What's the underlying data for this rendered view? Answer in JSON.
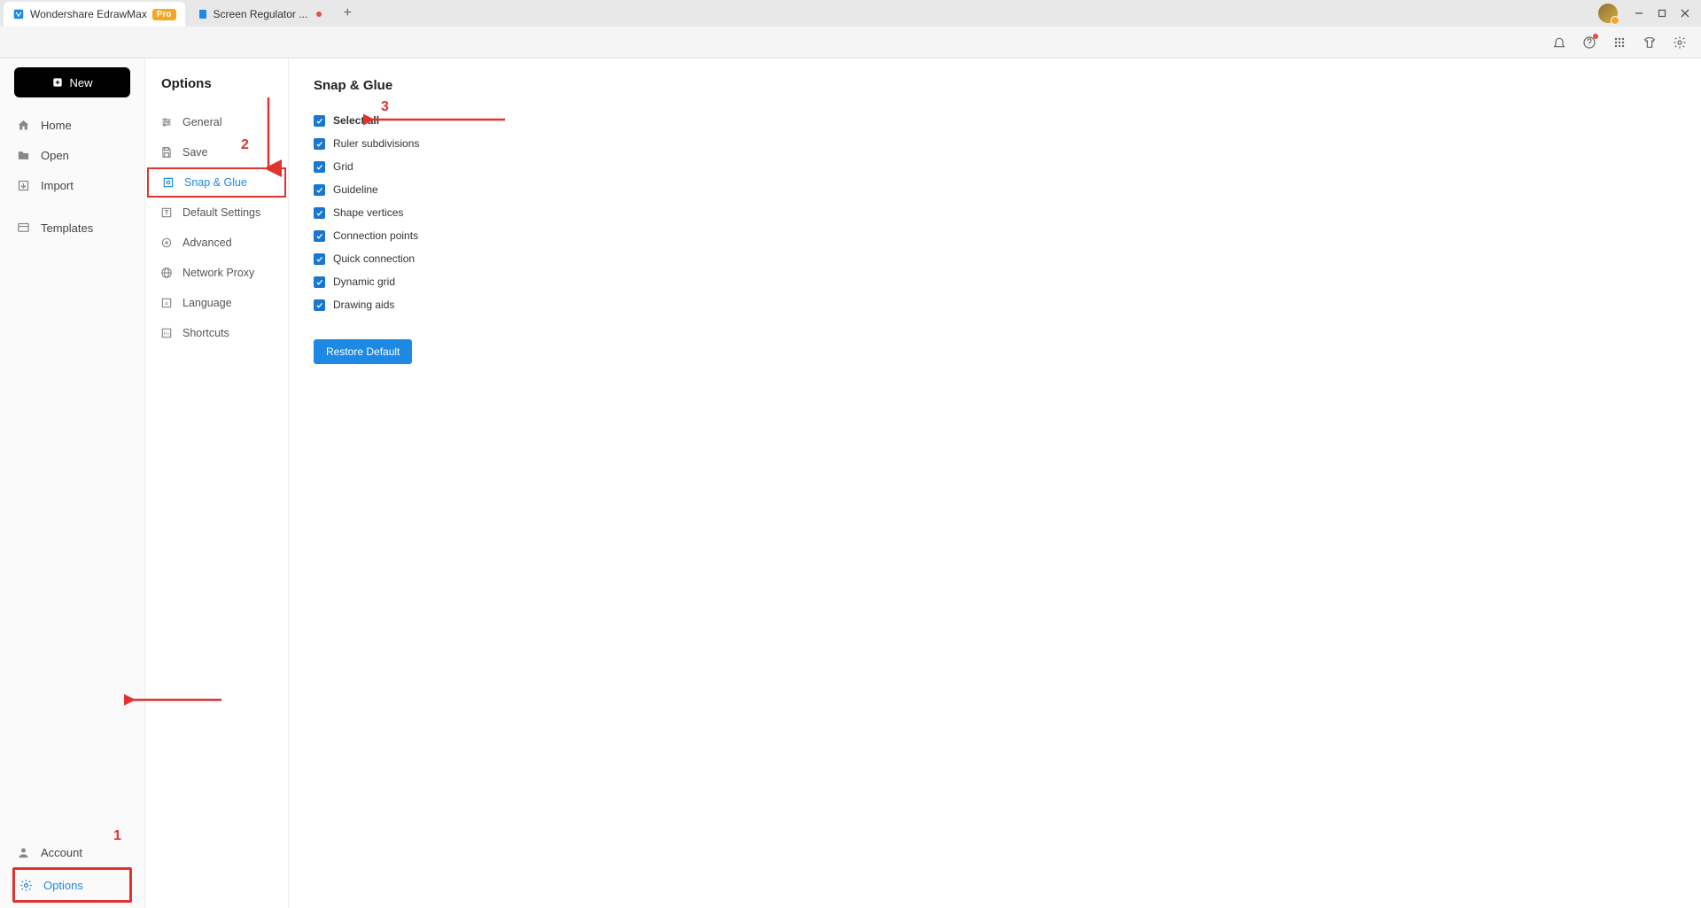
{
  "tabs": {
    "app_name": "Wondershare EdrawMax",
    "pro": "Pro",
    "second_tab": "Screen Regulator ..."
  },
  "sidebar": {
    "new_label": "New",
    "items": [
      "Home",
      "Open",
      "Import",
      "Templates"
    ],
    "bottom": [
      "Account",
      "Options"
    ]
  },
  "options": {
    "title": "Options",
    "items": [
      "General",
      "Save",
      "Snap & Glue",
      "Default Settings",
      "Advanced",
      "Network Proxy",
      "Language",
      "Shortcuts"
    ]
  },
  "content": {
    "title": "Snap & Glue",
    "checks": [
      "Select all",
      "Ruler subdivisions",
      "Grid",
      "Guideline",
      "Shape vertices",
      "Connection points",
      "Quick connection",
      "Dynamic grid",
      "Drawing aids"
    ],
    "restore": "Restore Default"
  },
  "annot": {
    "n1": "1",
    "n2": "2",
    "n3": "3"
  }
}
